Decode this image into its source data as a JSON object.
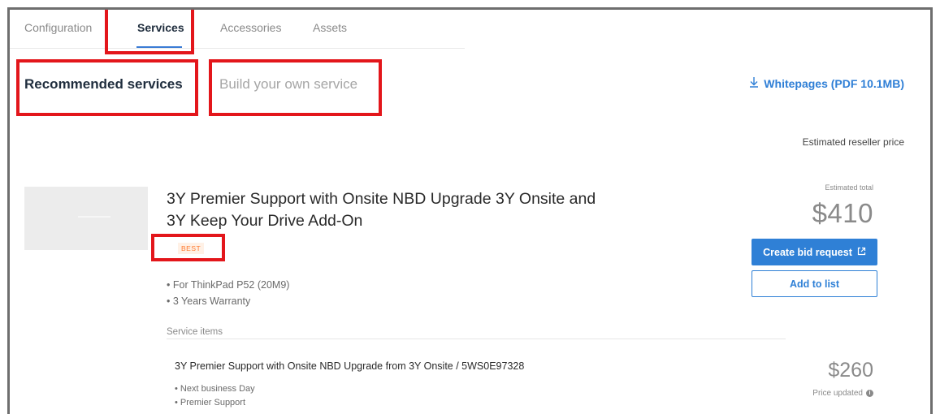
{
  "tabs": [
    {
      "label": "Configuration"
    },
    {
      "label": "Services"
    },
    {
      "label": "Accessories"
    },
    {
      "label": "Assets"
    }
  ],
  "subtabs": {
    "recommended": "Recommended services",
    "build_own": "Build your own service"
  },
  "whitepaper_link": "Whitepages (PDF 10.1MB)",
  "reseller_price_label": "Estimated reseller price",
  "product": {
    "title_line1": "3Y Premier Support with Onsite NBD Upgrade 3Y Onsite and",
    "title_line2": "3Y Keep Your Drive Add-On",
    "badge": "BEST",
    "bullets": [
      "For ThinkPad P52 (20M9)",
      "3 Years Warranty"
    ],
    "estimated_total_label": "Estimated total",
    "estimated_total": "$410",
    "create_bid_label": "Create bid request",
    "add_to_list_label": "Add to list"
  },
  "service_items_label": "Service items",
  "line_item": {
    "title": "3Y Premier Support with Onsite NBD  Upgrade from 3Y Onsite / 5WS0E97328",
    "bullets": [
      "Next business Day",
      "Premier Support"
    ],
    "price": "$260",
    "price_updated_label": "Price updated"
  },
  "colors": {
    "accent": "#2f80d6",
    "highlight": "#e3161b",
    "badge": "#ff7a2f"
  }
}
